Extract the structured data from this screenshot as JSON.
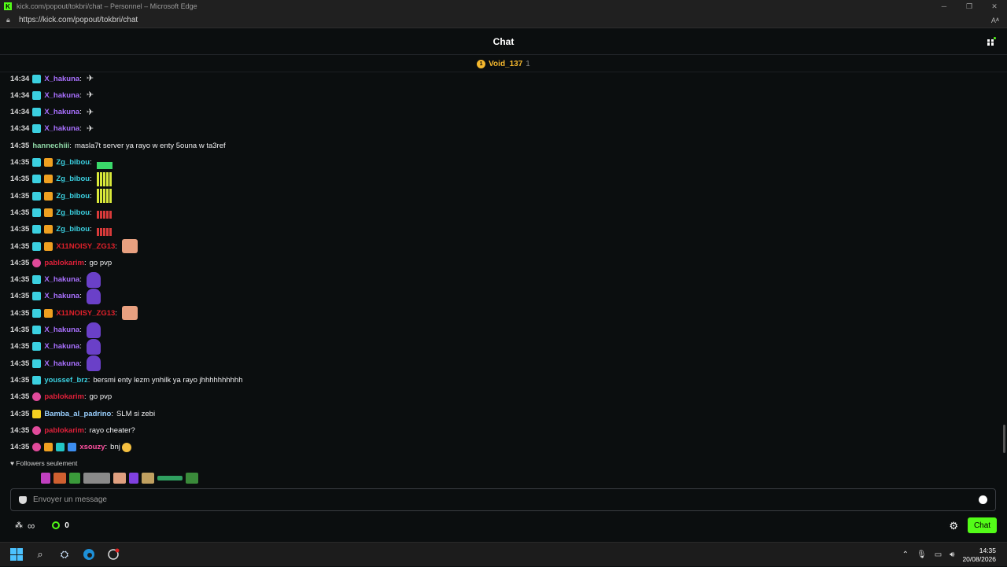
{
  "browser": {
    "window_title": "kick.com/popout/tokbri/chat – Personnel – Microsoft Edge",
    "url": "https://kick.com/popout/tokbri/chat",
    "logo_letter": "K",
    "read_aloud": "A̅"
  },
  "chat": {
    "title": "Chat",
    "pinned": {
      "name": "Void_137",
      "count": "1"
    },
    "messages": [
      {
        "time": "14:34",
        "badges": [
          "sub"
        ],
        "user": "X_hakuna",
        "color": "#a970ff",
        "text": "",
        "emote": "plane"
      },
      {
        "time": "14:34",
        "badges": [
          "sub"
        ],
        "user": "X_hakuna",
        "color": "#a970ff",
        "text": "",
        "emote": "plane"
      },
      {
        "time": "14:34",
        "badges": [
          "sub"
        ],
        "user": "X_hakuna",
        "color": "#a970ff",
        "text": "",
        "emote": "plane"
      },
      {
        "time": "14:34",
        "badges": [
          "sub"
        ],
        "user": "X_hakuna",
        "color": "#a970ff",
        "text": "",
        "emote": "plane"
      },
      {
        "time": "14:35",
        "badges": [],
        "user": "hannechiii",
        "color": "#8fd9a8",
        "text": "masla7t server ya rayo w enty 5ouna w ta3ref",
        "emote": ""
      },
      {
        "time": "14:35",
        "badges": [
          "sub",
          "crown"
        ],
        "user": "Zg_bibou",
        "color": "#3bd0e0",
        "text": "",
        "emote": "bars-green"
      },
      {
        "time": "14:35",
        "badges": [
          "sub",
          "crown"
        ],
        "user": "Zg_bibou",
        "color": "#3bd0e0",
        "text": "",
        "emote": "bars-yellow"
      },
      {
        "time": "14:35",
        "badges": [
          "sub",
          "crown"
        ],
        "user": "Zg_bibou",
        "color": "#3bd0e0",
        "text": "",
        "emote": "bars-yellow"
      },
      {
        "time": "14:35",
        "badges": [
          "sub",
          "crown"
        ],
        "user": "Zg_bibou",
        "color": "#3bd0e0",
        "text": "",
        "emote": "bars-red"
      },
      {
        "time": "14:35",
        "badges": [
          "sub",
          "crown"
        ],
        "user": "Zg_bibou",
        "color": "#3bd0e0",
        "text": "",
        "emote": "bars-red"
      },
      {
        "time": "14:35",
        "badges": [
          "sub",
          "crown"
        ],
        "user": "X11NOISY_ZG13",
        "color": "#e0202a",
        "text": "",
        "emote": "face"
      },
      {
        "time": "14:35",
        "badges": [
          "gift"
        ],
        "user": "pablokarim",
        "color": "#e0203a",
        "text": "go pvp",
        "emote": ""
      },
      {
        "time": "14:35",
        "badges": [
          "sub"
        ],
        "user": "X_hakuna",
        "color": "#a970ff",
        "text": "",
        "emote": "ghost"
      },
      {
        "time": "14:35",
        "badges": [
          "sub"
        ],
        "user": "X_hakuna",
        "color": "#a970ff",
        "text": "",
        "emote": "ghost"
      },
      {
        "time": "14:35",
        "badges": [
          "sub",
          "crown"
        ],
        "user": "X11NOISY_ZG13",
        "color": "#e0202a",
        "text": "",
        "emote": "face"
      },
      {
        "time": "14:35",
        "badges": [
          "sub"
        ],
        "user": "X_hakuna",
        "color": "#a970ff",
        "text": "",
        "emote": "ghost"
      },
      {
        "time": "14:35",
        "badges": [
          "sub"
        ],
        "user": "X_hakuna",
        "color": "#a970ff",
        "text": "",
        "emote": "ghost"
      },
      {
        "time": "14:35",
        "badges": [
          "sub"
        ],
        "user": "X_hakuna",
        "color": "#a970ff",
        "text": "",
        "emote": "ghost"
      },
      {
        "time": "14:35",
        "badges": [
          "sub"
        ],
        "user": "youssef_brz",
        "color": "#3bd0e0",
        "text": "bersmi enty lezm ynhilk ya rayo jhhhhhhhhhh",
        "emote": ""
      },
      {
        "time": "14:35",
        "badges": [
          "gift"
        ],
        "user": "pablokarim",
        "color": "#e0203a",
        "text": "go pvp",
        "emote": ""
      },
      {
        "time": "14:35",
        "badges": [
          "og"
        ],
        "user": "Bamba_al_padrino",
        "color": "#9ad0ff",
        "text": "SLM si zebi",
        "emote": ""
      },
      {
        "time": "14:35",
        "badges": [
          "gift"
        ],
        "user": "pablokarim",
        "color": "#e0203a",
        "text": "rayo cheater?",
        "emote": ""
      },
      {
        "time": "14:35",
        "badges": [
          "gift",
          "crown",
          "teal",
          "blue"
        ],
        "user": "xsouzy",
        "color": "#ff4fa0",
        "text": "bnj",
        "emote": "sun"
      }
    ],
    "followers_only": "Followers seulement",
    "input_placeholder": "Envoyer un message",
    "points": "0",
    "chat_button": "Chat"
  },
  "taskbar": {
    "time": "14:35",
    "date": "20/08/2026"
  },
  "colors": {
    "brand": "#53fc18",
    "background": "#0b0e0f"
  }
}
